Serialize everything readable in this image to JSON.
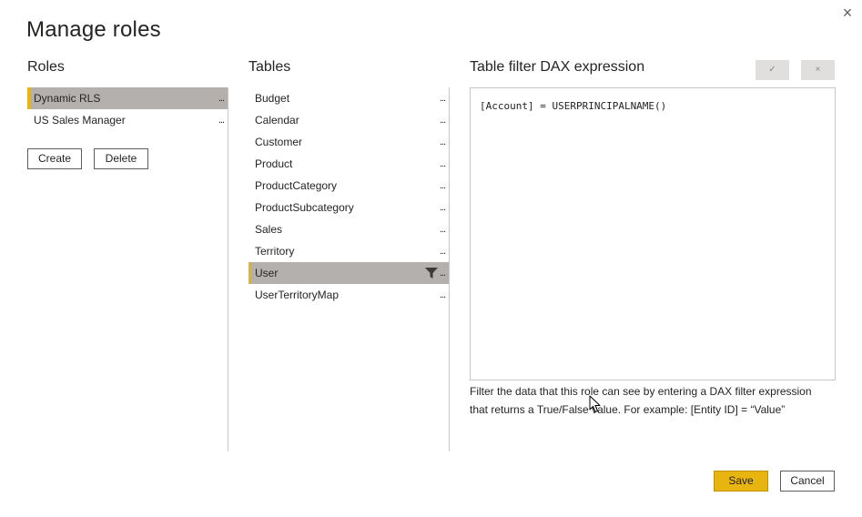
{
  "dialog": {
    "title": "Manage roles",
    "close_icon": "close-icon",
    "close_glyph": "×"
  },
  "roles": {
    "title": "Roles",
    "items": [
      {
        "label": "Dynamic RLS",
        "selected": true,
        "menu": "..."
      },
      {
        "label": "US Sales Manager",
        "selected": false,
        "menu": "..."
      }
    ],
    "create_label": "Create",
    "delete_label": "Delete"
  },
  "tables": {
    "title": "Tables",
    "items": [
      {
        "label": "Budget",
        "menu": "..."
      },
      {
        "label": "Calendar",
        "menu": "..."
      },
      {
        "label": "Customer",
        "menu": "..."
      },
      {
        "label": "Product",
        "menu": "..."
      },
      {
        "label": "ProductCategory",
        "menu": "..."
      },
      {
        "label": "ProductSubcategory",
        "menu": "..."
      },
      {
        "label": "Sales",
        "menu": "..."
      },
      {
        "label": "Territory",
        "menu": "..."
      },
      {
        "label": "User",
        "menu": "...",
        "selected": true,
        "has_filter": true
      },
      {
        "label": "UserTerritoryMap",
        "menu": "..."
      }
    ]
  },
  "dax": {
    "title": "Table filter DAX expression",
    "confirm_glyph": "✓",
    "cancel_glyph": "×",
    "expression": "[Account] = USERPRINCIPALNAME()",
    "help_line1": "Filter the data that this role can see by entering a DAX filter expression",
    "help_line2": "that returns a True/False value. For example: [Entity ID] = “Value”"
  },
  "footer": {
    "save_label": "Save",
    "cancel_label": "Cancel"
  },
  "colors": {
    "accent": "#e8b40f",
    "selected_bg": "#b3b0ad",
    "border": "#c8c6c4"
  }
}
